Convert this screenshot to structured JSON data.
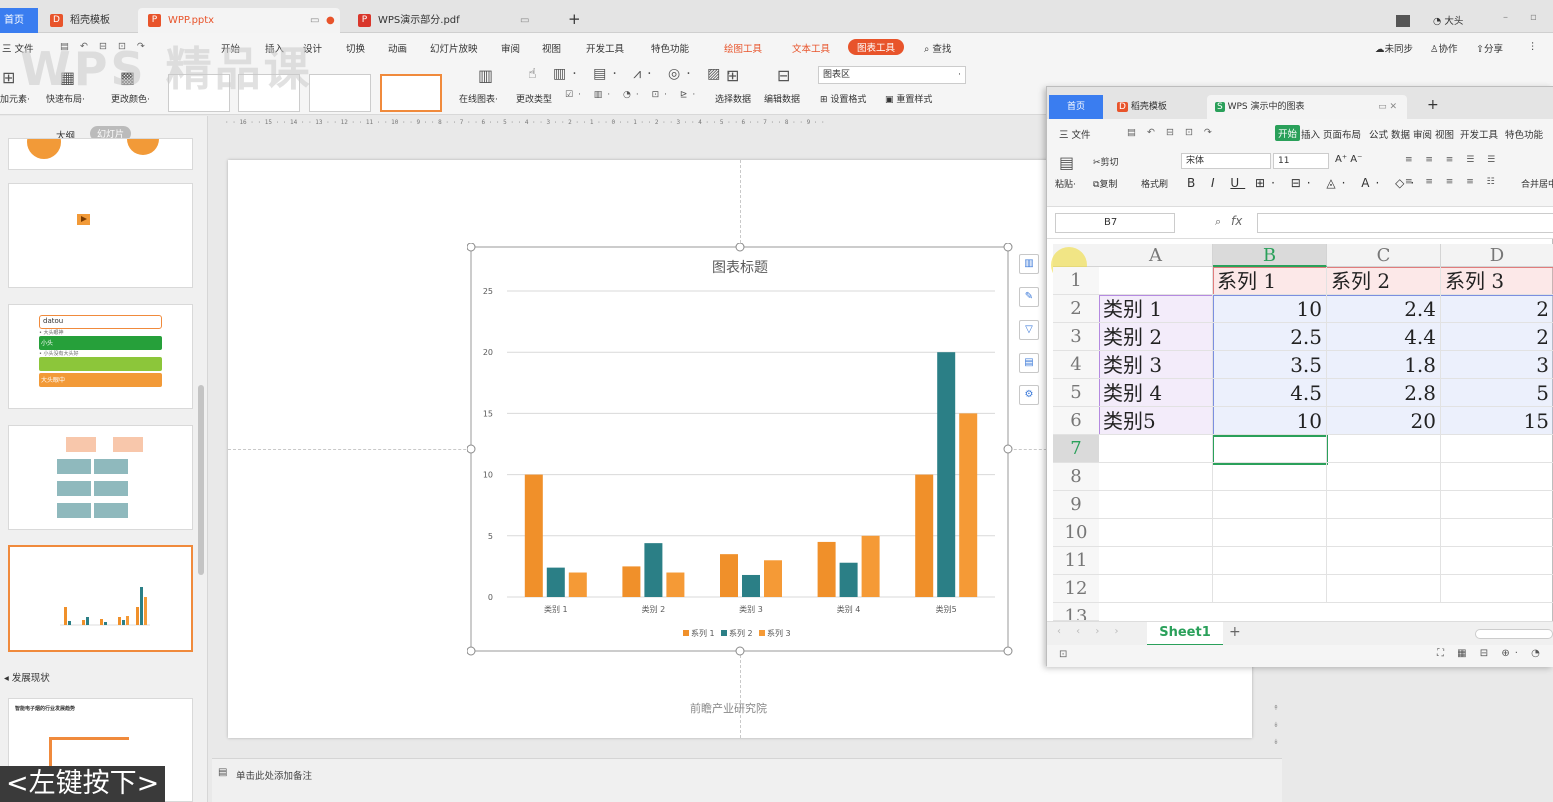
{
  "tabs": {
    "home": "首页",
    "t1": "稻壳模板",
    "t2": "WPP.pptx",
    "t3": "WPS演示部分.pdf",
    "add": "+",
    "user": "大头"
  },
  "menu": [
    "三 文件",
    "开始",
    "插入",
    "设计",
    "切换",
    "动画",
    "幻灯片放映",
    "审阅",
    "视图",
    "开发工具",
    "特色功能",
    "绘图工具",
    "文本工具",
    "图表工具",
    "查找"
  ],
  "menu_right": [
    "未同步",
    "协作",
    "分享"
  ],
  "ribbon": {
    "add_element": "加元素·",
    "quick_layout": "快速布局·",
    "change_color": "更改颜色·",
    "online_chart": "在线图表·",
    "change_type": "更改类型",
    "select_data": "选择数据",
    "edit_data": "编辑数据",
    "chart_area": "图表区",
    "set_format": "设置格式",
    "reset_style": "重置样式"
  },
  "watermark": "WPS 精品课",
  "left_panel": {
    "outline": "大纲",
    "slides": "幻灯片",
    "section": "发展现状",
    "slide3_title": "datou",
    "slide3_items": [
      "• 大头眼神",
      "小头",
      "• 小头没有大头好",
      "大头眼中"
    ],
    "slide6_title": "智能电子烟的行业发展趋势"
  },
  "caption": "<左键按下>",
  "notes": "单击此处添加备注",
  "ruler": "· · 16 · · 15 · · 14 · · 13 · · 12 · · 11 · · 10 · · 9 · · 8 · · 7 · · 6 · · 5 · · 4 · · 3 · · 2 · · 1 · · 0 · · 1 · · 2 · · 3 · · 4 · · 5 · · 6 · · 7 · · 8 · · 9 · ·",
  "slide_footer": "前瞻产业研究院",
  "chart_data": {
    "type": "bar",
    "title": "图表标题",
    "categories": [
      "类别 1",
      "类别 2",
      "类别 3",
      "类别 4",
      "类别5"
    ],
    "series": [
      {
        "name": "系列 1",
        "values": [
          10,
          2.5,
          3.5,
          4.5,
          10
        ],
        "color": "#f0902a"
      },
      {
        "name": "系列 2",
        "values": [
          2.4,
          4.4,
          1.8,
          2.8,
          20
        ],
        "color": "#2b7f86"
      },
      {
        "name": "系列 3",
        "values": [
          2,
          2,
          3,
          5,
          15
        ],
        "color": "#f59a36"
      }
    ],
    "ylim": [
      0,
      25
    ],
    "yticks": [
      "0",
      "5",
      "10",
      "15",
      "20",
      "25"
    ],
    "grid": true,
    "legend": "bottom"
  },
  "spreadsheet": {
    "home": "首页",
    "tab1": "稻壳模板",
    "tab2": "WPS 演示中的图表",
    "add": "+",
    "menu": [
      "三 文件",
      "开始",
      "插入",
      "页面布局",
      "公式",
      "数据",
      "审阅",
      "视图",
      "开发工具",
      "特色功能"
    ],
    "tool": {
      "paste": "粘贴·",
      "cut": "剪切",
      "copy": "复制",
      "format_painter": "格式刷",
      "font": "宋体",
      "size": "11",
      "merge": "合并居中"
    },
    "cell_ref": "B7",
    "fx": "fx",
    "columns": [
      "A",
      "B",
      "C",
      "D"
    ],
    "rows": [
      "1",
      "2",
      "3",
      "4",
      "5",
      "6",
      "7",
      "8",
      "9",
      "10",
      "11",
      "12",
      "13"
    ],
    "header_row": [
      "",
      "系列 1",
      "系列 2",
      "系列 3"
    ],
    "data_rows": [
      [
        "类别 1",
        "10",
        "2.4",
        "2"
      ],
      [
        "类别 2",
        "2.5",
        "4.4",
        "2"
      ],
      [
        "类别 3",
        "3.5",
        "1.8",
        "3"
      ],
      [
        "类别 4",
        "4.5",
        "2.8",
        "5"
      ],
      [
        "类别5",
        "10",
        "20",
        "15"
      ]
    ],
    "sheet": "Sheet1"
  }
}
